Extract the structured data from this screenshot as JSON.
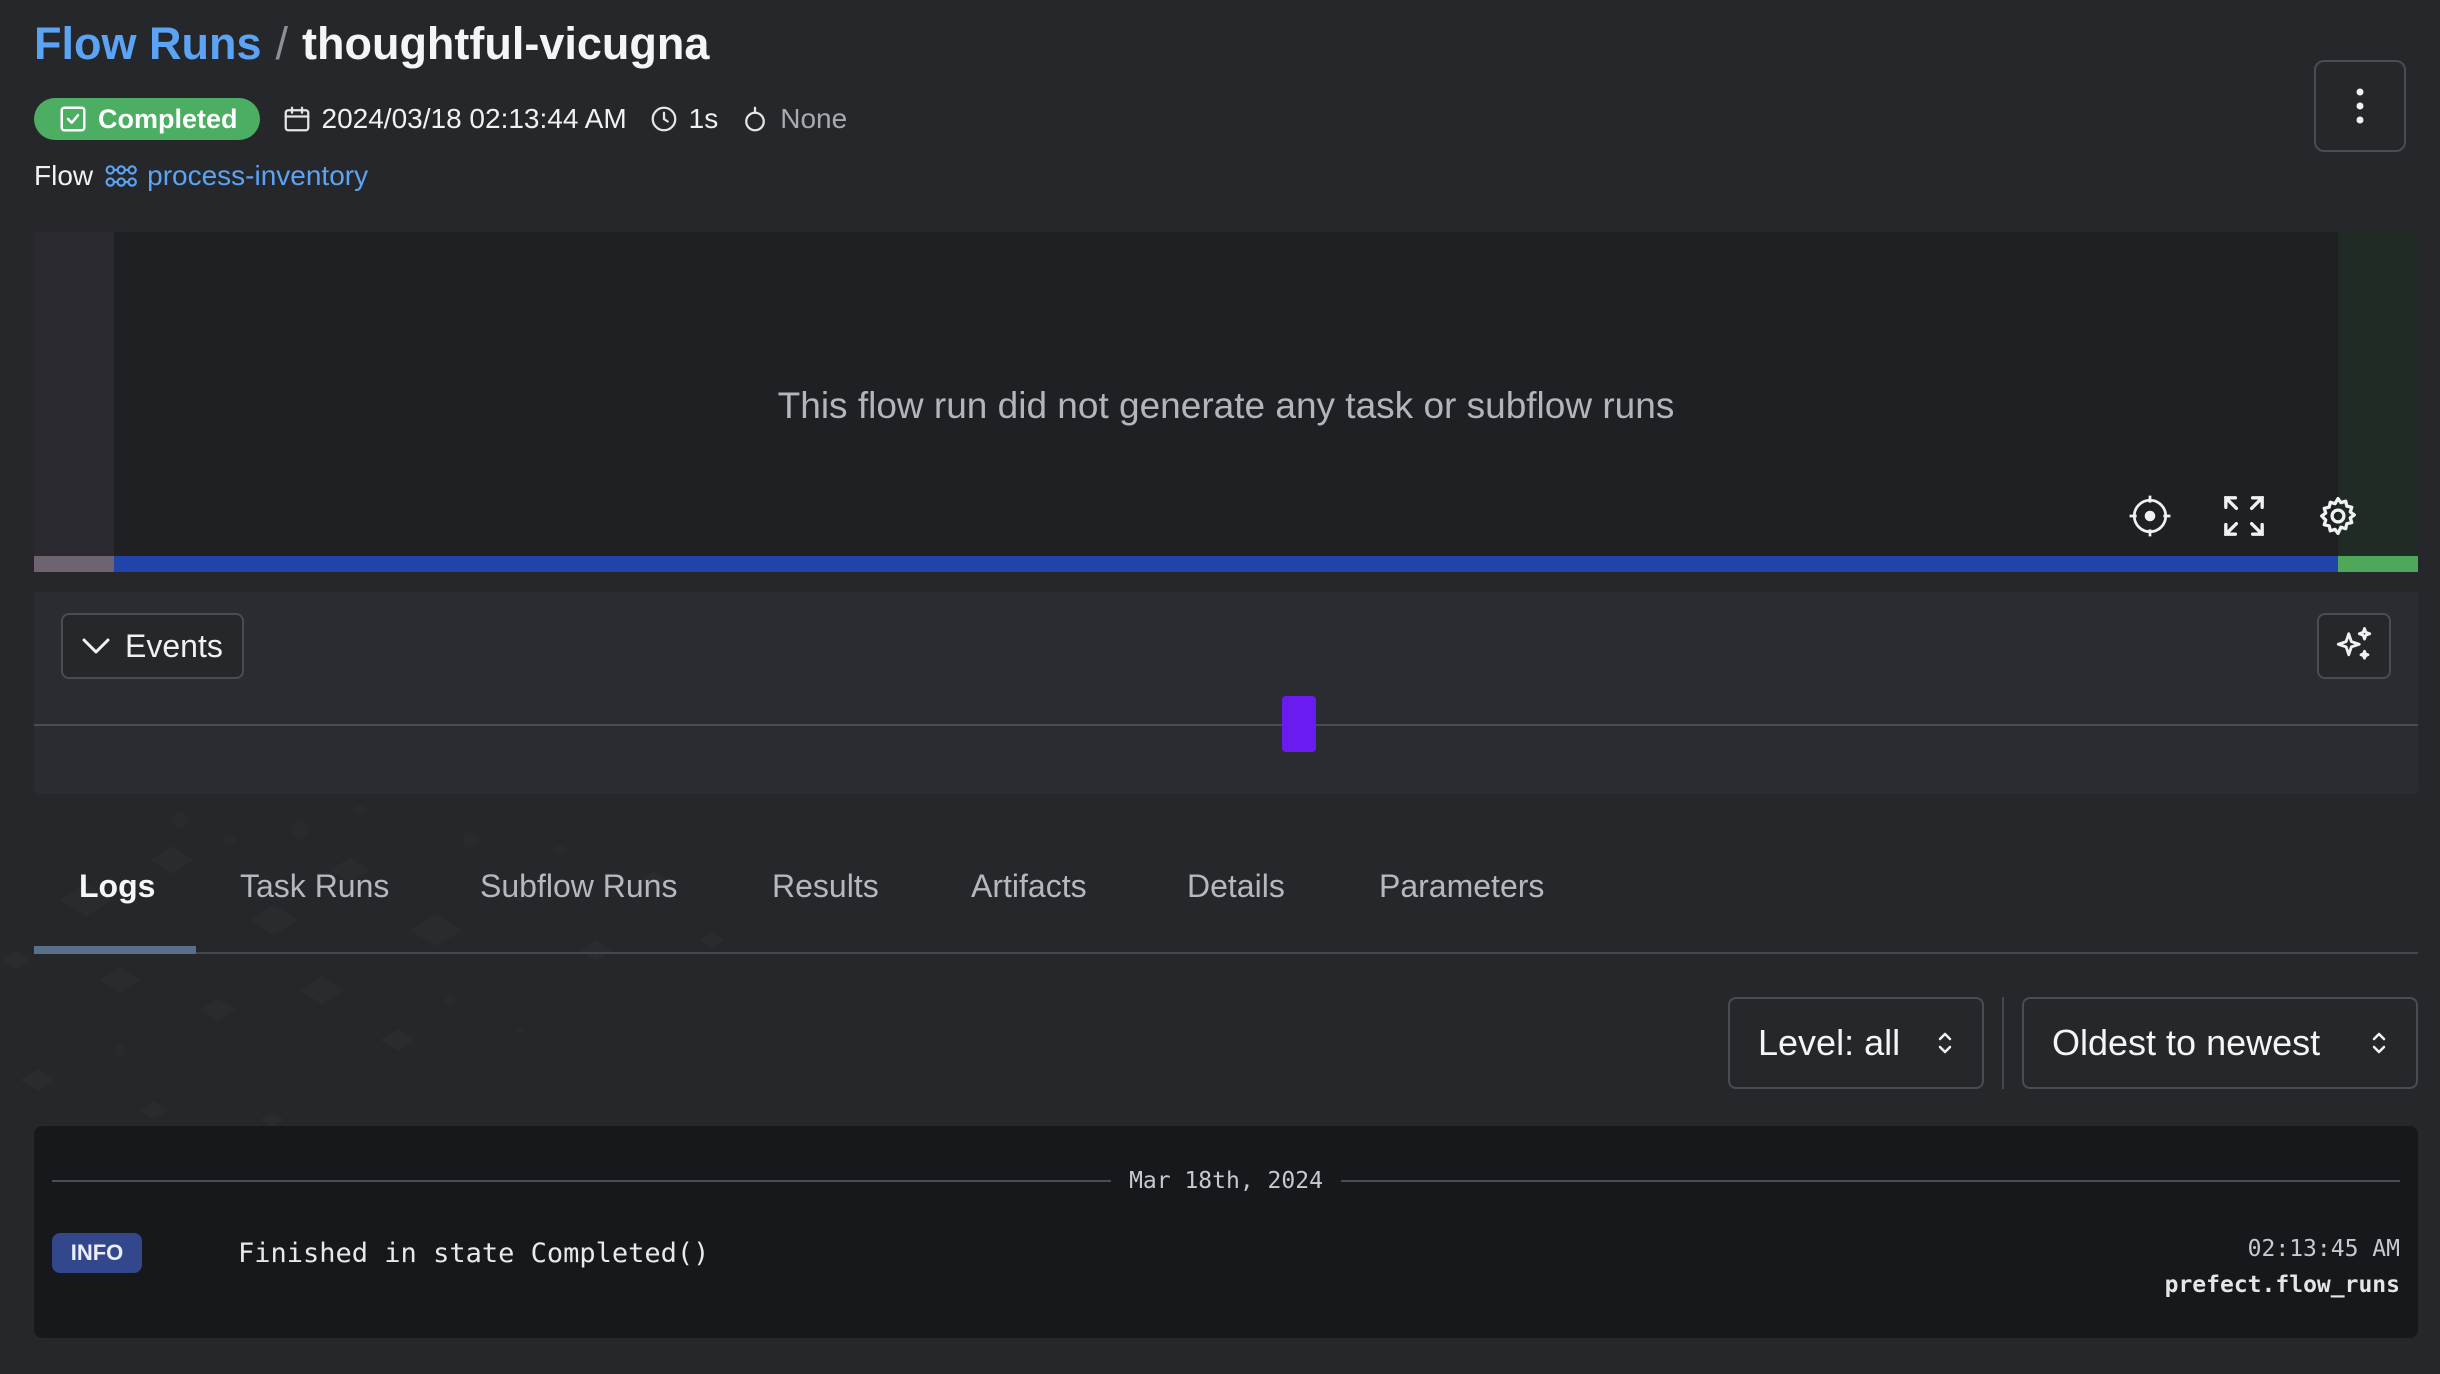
{
  "breadcrumb": {
    "root": "Flow Runs",
    "separator": "/",
    "current": "thoughtful-vicugna"
  },
  "meta": {
    "state": "Completed",
    "start_time": "2024/03/18 02:13:44 AM",
    "duration": "1s",
    "tags": "None"
  },
  "flow": {
    "label": "Flow",
    "name": "process-inventory"
  },
  "graph": {
    "empty_message": "This flow run did not generate any task or subflow runs"
  },
  "events": {
    "toggle_label": "Events"
  },
  "tabs": [
    {
      "label": "Logs",
      "active": true
    },
    {
      "label": "Task Runs"
    },
    {
      "label": "Subflow Runs"
    },
    {
      "label": "Results"
    },
    {
      "label": "Artifacts"
    },
    {
      "label": "Details"
    },
    {
      "label": "Parameters"
    }
  ],
  "filters": {
    "level": "Level: all",
    "order": "Oldest to newest"
  },
  "logs": {
    "date_header": "Mar 18th, 2024",
    "entries": [
      {
        "level": "INFO",
        "message": "Finished in state Completed()",
        "time": "02:13:45 AM",
        "logger": "prefect.flow_runs"
      }
    ]
  },
  "colors": {
    "accent_link": "#5ba4f5",
    "state_completed": "#4cae62",
    "event_marker": "#6a1cf0",
    "timeline_running": "#2244aa",
    "info_badge": "#33478c"
  },
  "icons": {
    "state": "check-square-icon",
    "start_time": "calendar-icon",
    "duration": "clock-icon",
    "tags": "tag-icon",
    "flow": "flow-icon",
    "menu": "kebab-menu-icon",
    "recenter": "crosshair-icon",
    "fullscreen": "expand-icon",
    "settings": "gear-icon",
    "events_toggle": "chevron-down-icon",
    "sparkle": "sparkles-icon"
  }
}
